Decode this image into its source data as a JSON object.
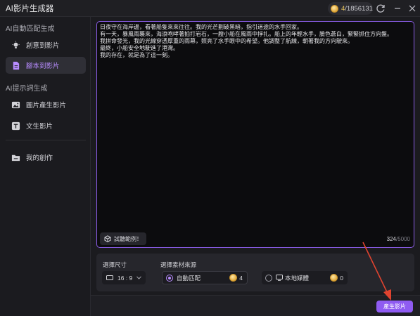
{
  "app": {
    "title": "AI影片生成器"
  },
  "credits": {
    "current": "4",
    "total": "/1856131"
  },
  "sidebar": {
    "section1": "AI自動匹配生成",
    "items1": [
      {
        "label": "創意到影片",
        "icon": "bulb-icon",
        "active": false
      },
      {
        "label": "腳本到影片",
        "icon": "script-icon",
        "active": true
      }
    ],
    "section2": "AI提示詞生成",
    "items2": [
      {
        "label": "圖片產生影片",
        "icon": "image-icon"
      },
      {
        "label": "文生影片",
        "icon": "text-icon"
      }
    ],
    "my_works": "我的創作"
  },
  "editor": {
    "script_text": "日夜守在海岸邊，看著船隻來來往往。我的光芒劃破黑暗，指引迷途的水手回家。\n有一天，暴風雨襲來，海浪咆哮著拍打岩石，一艘小船在風雨中掙扎。船上的年輕水手，臉色蒼白，緊緊抓住方向盤。\n我拼命發光，我的光線穿透厚重的雨幕，照亮了水手眼中的希望。他調整了航線，朝著我的方向駛來。\n最終，小船安全地駛進了港灣。\n我的存在，就是為了這一刻。",
    "try_example": "試聽範例！",
    "char_count": "324",
    "char_max": "/5000"
  },
  "settings": {
    "ratio_label": "選擇尺寸",
    "ratio_value": "16 : 9",
    "source_label": "選擇素材來源",
    "options": [
      {
        "label": "自動匹配",
        "cost": "4",
        "selected": true
      },
      {
        "label": "本地媒體",
        "cost": "0",
        "selected": false
      }
    ]
  },
  "generate_button": "產生影片",
  "colors": {
    "accent": "#8f5bf2",
    "active_text": "#b88cff",
    "annotation_arrow": "#e0432f"
  }
}
